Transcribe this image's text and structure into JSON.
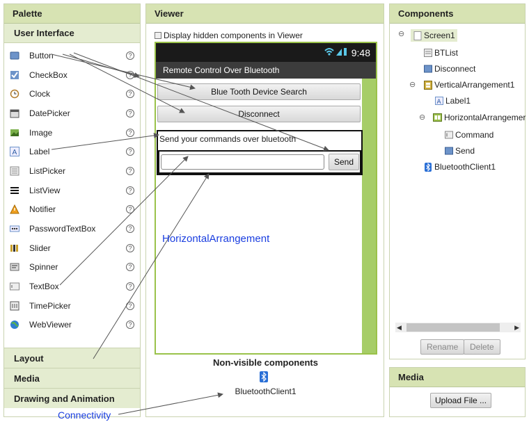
{
  "palette": {
    "title": "Palette",
    "section": "User Interface",
    "items": [
      {
        "label": "Button",
        "icon": "button-icon",
        "help": "?"
      },
      {
        "label": "CheckBox",
        "icon": "checkbox-icon",
        "help": "?"
      },
      {
        "label": "Clock",
        "icon": "clock-icon",
        "help": "?"
      },
      {
        "label": "DatePicker",
        "icon": "datepicker-icon",
        "help": "?"
      },
      {
        "label": "Image",
        "icon": "image-icon",
        "help": "?"
      },
      {
        "label": "Label",
        "icon": "label-icon",
        "help": "?"
      },
      {
        "label": "ListPicker",
        "icon": "listpicker-icon",
        "help": "?"
      },
      {
        "label": "ListView",
        "icon": "listview-icon",
        "help": "?"
      },
      {
        "label": "Notifier",
        "icon": "notifier-icon",
        "help": "?"
      },
      {
        "label": "PasswordTextBox",
        "icon": "password-icon",
        "help": "?"
      },
      {
        "label": "Slider",
        "icon": "slider-icon",
        "help": "?"
      },
      {
        "label": "Spinner",
        "icon": "spinner-icon",
        "help": "?"
      },
      {
        "label": "TextBox",
        "icon": "textbox-icon",
        "help": "?"
      },
      {
        "label": "TimePicker",
        "icon": "timepicker-icon",
        "help": "?"
      },
      {
        "label": "WebViewer",
        "icon": "webviewer-icon",
        "help": "?"
      }
    ],
    "categories": [
      "Layout",
      "Media",
      "Drawing and Animation"
    ]
  },
  "viewer": {
    "title": "Viewer",
    "checkbox_label": "Display hidden components in Viewer",
    "status_time": "9:48",
    "app_title": "Remote Control Over Bluetooth",
    "btn_search": "Blue Tooth Device Search",
    "btn_disconnect": "Disconnect",
    "label_text": "Send your commands over bluetooth",
    "send_label": "Send",
    "nonvisible_title": "Non-visible components",
    "nonvisible_item": "BluetoothClient1"
  },
  "components": {
    "title": "Components",
    "tree": {
      "screen": "Screen1",
      "btlist": "BTList",
      "disconnect": "Disconnect",
      "varr": "VerticalArrangement1",
      "label1": "Label1",
      "harr": "HorizontalArrangemer",
      "command": "Command",
      "send": "Send",
      "bt": "BluetoothClient1"
    },
    "rename": "Rename",
    "delete": "Delete"
  },
  "media": {
    "title": "Media",
    "upload": "Upload File ..."
  },
  "annotations": {
    "horizontal": "HorizontalArrangement",
    "connectivity": "Connectivity"
  },
  "colors": {
    "header_bg": "#d7e3b3",
    "accent_green": "#9ac24a",
    "annotation_blue": "#1a3ee0"
  }
}
